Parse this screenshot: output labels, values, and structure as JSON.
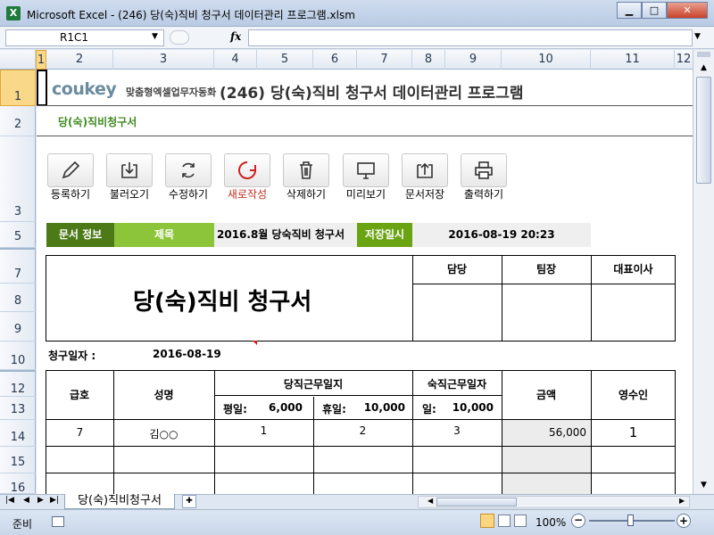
{
  "window": {
    "title": "Microsoft Excel - (246) 당(숙)직비 청구서 데이터관리 프로그램.xlsm",
    "app_icon": "X"
  },
  "formula": {
    "name_box": "R1C1",
    "fx": "fx",
    "content": ""
  },
  "columns": [
    "1",
    "2",
    "3",
    "4",
    "5",
    "6",
    "7",
    "8",
    "9",
    "10",
    "11",
    "12"
  ],
  "rows": [
    "1",
    "2",
    "3",
    "5",
    "7",
    "8",
    "9",
    "10",
    "12",
    "13",
    "14",
    "15",
    "16"
  ],
  "banner": {
    "logo": "coukey",
    "tagline": "맞춤형엑셀업무자동화",
    "title": "(246) 당(숙)직비 청구서 데이터관리 프로그램",
    "subtitle": "당(숙)직비청구서"
  },
  "toolbar": {
    "buttons": [
      {
        "label": "등록하기",
        "icon": "pencil-icon"
      },
      {
        "label": "불러오기",
        "icon": "download-icon"
      },
      {
        "label": "수정하기",
        "icon": "refresh-icon"
      },
      {
        "label": "새로작성",
        "icon": "new-doc-icon"
      },
      {
        "label": "삭제하기",
        "icon": "trash-icon"
      },
      {
        "label": "미리보기",
        "icon": "monitor-icon"
      },
      {
        "label": "문서저장",
        "icon": "upload-icon"
      },
      {
        "label": "출력하기",
        "icon": "printer-icon"
      }
    ]
  },
  "docinfo": {
    "label": "문서 정보",
    "title_label": "제목",
    "title_value": "2016.8월 당숙직비 청구서",
    "saved_label": "저장일시",
    "saved_value": "2016-08-19 20:23"
  },
  "form": {
    "title": "당(숙)직비 청구서",
    "approvals": [
      "담당",
      "팀장",
      "대표이사"
    ],
    "request_date_label": "청구일자 :",
    "request_date": "2016-08-19",
    "headers": {
      "grade": "급호",
      "name": "성명",
      "duty_days": "당직근무일지",
      "night_days": "숙직근무일자",
      "amount": "금액",
      "receipt": "영수인"
    },
    "sub": {
      "weekday_label": "평일:",
      "weekday_rate": "6,000",
      "holiday_label": "휴일:",
      "holiday_rate": "10,000",
      "night_label": "일:",
      "night_rate": "10,000"
    },
    "rows": [
      {
        "grade": "7",
        "name": "김○○",
        "weekday": "1",
        "holiday": "2",
        "night": "3",
        "amount": "56,000",
        "receipt": "1"
      }
    ]
  },
  "sheet_tab": "당(숙)직비청구서",
  "status": {
    "mode": "준비",
    "zoom": "100%"
  },
  "colors": {
    "accent_green": "#6aa412",
    "dark_green": "#4b7a16",
    "light_green": "#8cc43a"
  }
}
